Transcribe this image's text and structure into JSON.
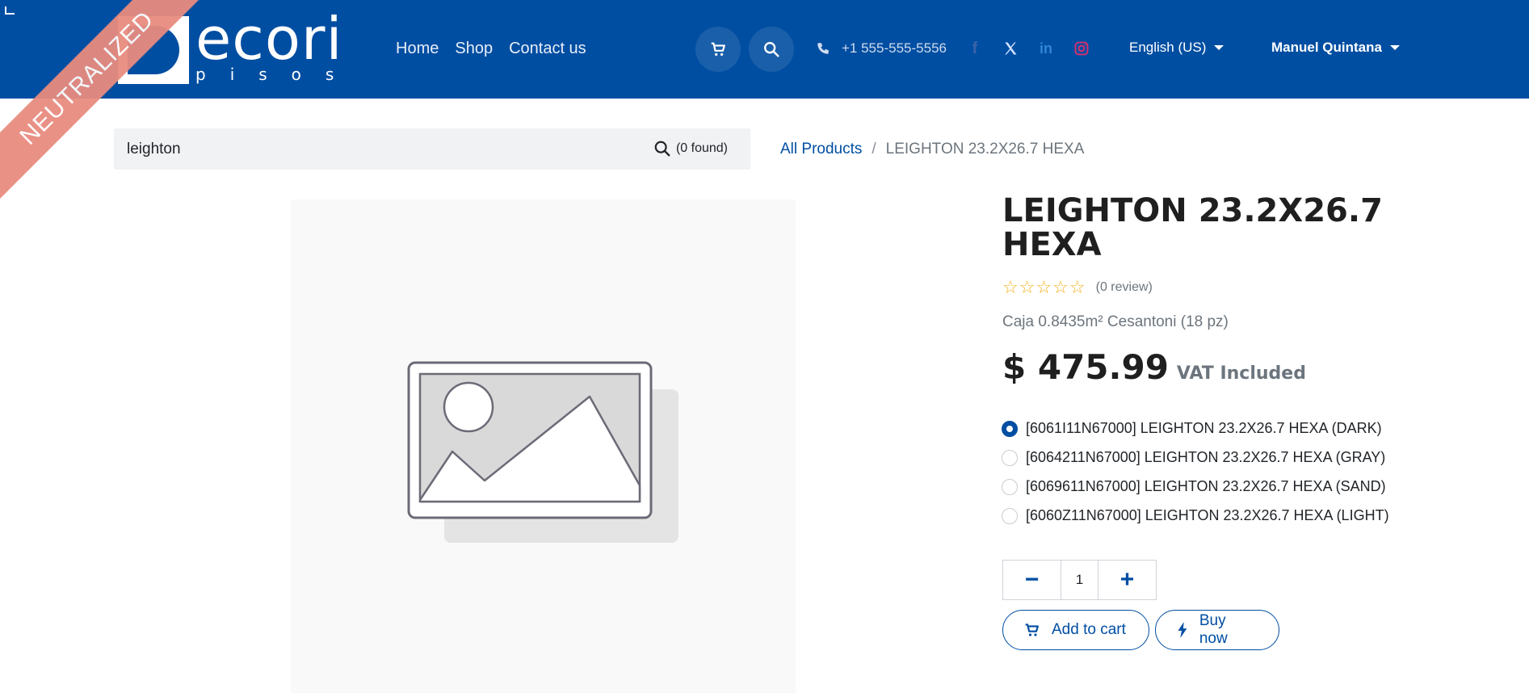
{
  "brand": {
    "logo_main": "ecori",
    "logo_sub": "pisos"
  },
  "nav": {
    "home": "Home",
    "shop": "Shop",
    "contact": "Contact us"
  },
  "header": {
    "phone": "+1 555-555-5556",
    "language": "English (US)",
    "user": "Manuel Quintana"
  },
  "ribbon": {
    "label": "NEUTRALIZED"
  },
  "search": {
    "value": "leighton",
    "found": "(0 found)"
  },
  "breadcrumb": {
    "root": "All Products",
    "separator": "/",
    "current": "LEIGHTON 23.2X26.7 HEXA"
  },
  "product": {
    "title": "LEIGHTON 23.2X26.7 HEXA",
    "stars": "☆☆☆☆☆",
    "review_count": "(0 review)",
    "subtitle": "Caja 0.8435m² Cesantoni (18 pz)",
    "price": "$ 475.99",
    "vat": "VAT Included",
    "variants": [
      {
        "label": "[6061I11N67000] LEIGHTON 23.2X26.7 HEXA (DARK)",
        "selected": true
      },
      {
        "label": "[6064211N67000] LEIGHTON 23.2X26.7 HEXA (GRAY)",
        "selected": false
      },
      {
        "label": "[6069611N67000] LEIGHTON 23.2X26.7 HEXA (SAND)",
        "selected": false
      },
      {
        "label": "[6060Z11N67000] LEIGHTON 23.2X26.7 HEXA (LIGHT)",
        "selected": false
      }
    ],
    "quantity": "1",
    "minus": "−",
    "plus": "+"
  },
  "actions": {
    "add_to_cart": "Add to cart",
    "buy_now": "Buy now"
  },
  "icons": {
    "cart": "cart-icon",
    "search": "search-icon",
    "phone": "phone-icon",
    "facebook": "facebook-icon",
    "x": "x-icon",
    "linkedin": "linkedin-icon",
    "instagram": "instagram-icon",
    "image_placeholder": "image-placeholder-icon",
    "bolt": "bolt-icon"
  },
  "colors": {
    "primary": "#004ea2",
    "star": "#f2b21b",
    "ribbon": "#e88c7f"
  }
}
